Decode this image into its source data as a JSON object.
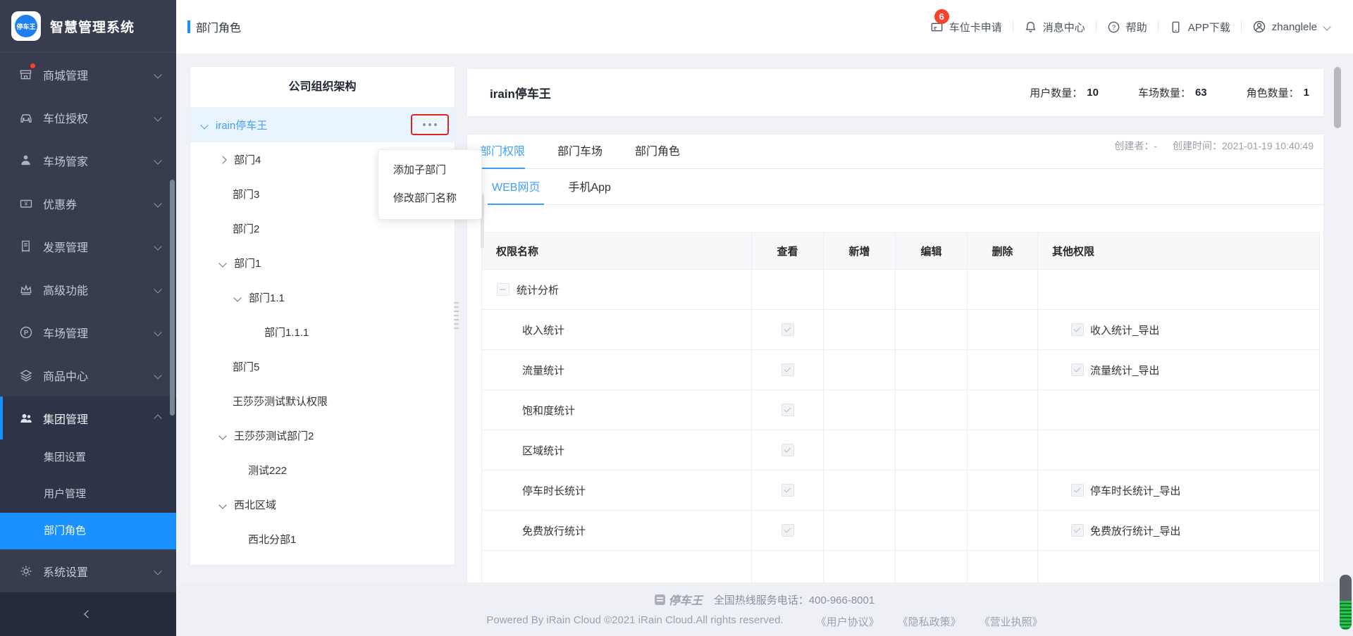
{
  "app": {
    "name": "智慧管理系统",
    "logo_badge": "停车王"
  },
  "sidebar": {
    "items": [
      {
        "label": "商城管理",
        "icon": "store-icon",
        "has_badge_dot": true
      },
      {
        "label": "车位授权",
        "icon": "car-icon"
      },
      {
        "label": "车场管家",
        "icon": "steward-icon"
      },
      {
        "label": "优惠券",
        "icon": "coupon-icon"
      },
      {
        "label": "发票管理",
        "icon": "invoice-icon"
      },
      {
        "label": "高级功能",
        "icon": "crown-icon"
      },
      {
        "label": "车场管理",
        "icon": "parking-icon"
      },
      {
        "label": "商品中心",
        "icon": "goods-icon"
      },
      {
        "label": "集团管理",
        "icon": "group-icon",
        "expanded": true
      },
      {
        "label": "系统设置",
        "icon": "settings-icon"
      }
    ],
    "group_children": [
      {
        "label": "集团设置"
      },
      {
        "label": "用户管理"
      },
      {
        "label": "部门角色",
        "active": true
      }
    ]
  },
  "header": {
    "breadcrumb": "部门角色",
    "badge_count": "6",
    "actions": [
      {
        "label": "车位卡申请",
        "icon": "card-icon"
      },
      {
        "label": "消息中心",
        "icon": "bell-icon"
      },
      {
        "label": "帮助",
        "icon": "help-icon"
      },
      {
        "label": "APP下载",
        "icon": "phone-icon"
      }
    ],
    "user": {
      "name": "zhanglele",
      "icon": "user-icon"
    }
  },
  "org_panel": {
    "title": "公司组织架构",
    "nodes": [
      {
        "label": "irain停车王",
        "level": 0,
        "caret": "down",
        "selected": true
      },
      {
        "label": "部门4",
        "level": 1,
        "caret": "right"
      },
      {
        "label": "部门3",
        "level": 1
      },
      {
        "label": "部门2",
        "level": 1
      },
      {
        "label": "部门1",
        "level": 1,
        "caret": "down"
      },
      {
        "label": "部门1.1",
        "level": 2,
        "caret": "down"
      },
      {
        "label": "部门1.1.1",
        "level": 3
      },
      {
        "label": "部门5",
        "level": 1
      },
      {
        "label": "王莎莎测试默认权限",
        "level": 1
      },
      {
        "label": "王莎莎测试部门2",
        "level": 1,
        "caret": "down"
      },
      {
        "label": "测试222",
        "level": 2
      },
      {
        "label": "西北区域",
        "level": 1,
        "caret": "down"
      },
      {
        "label": "西北分部1",
        "level": 2
      }
    ],
    "context_menu": [
      {
        "label": "添加子部门"
      },
      {
        "label": "修改部门名称"
      }
    ]
  },
  "content": {
    "company_name": "irain停车王",
    "stats": [
      {
        "label": "用户数量：",
        "value": "10"
      },
      {
        "label": "车场数量：",
        "value": "63"
      },
      {
        "label": "角色数量：",
        "value": "1"
      }
    ],
    "tabs": [
      {
        "label": "部门权限",
        "active": true
      },
      {
        "label": "部门车场"
      },
      {
        "label": "部门角色"
      }
    ],
    "meta": {
      "creator_label": "创建者：",
      "creator_value": "-",
      "created_label": "创建时间：",
      "created_value": "2021-01-19 10:40:49"
    },
    "subtabs": [
      {
        "label": "WEB网页",
        "active": true
      },
      {
        "label": "手机App"
      }
    ],
    "table": {
      "columns": [
        "权限名称",
        "查看",
        "新增",
        "编辑",
        "删除",
        "其他权限"
      ],
      "rows": [
        {
          "name": "统计分析",
          "is_group": true,
          "checkbox": "indeterminate"
        },
        {
          "name": "收入统计",
          "view": "checked",
          "other": "收入统计_导出"
        },
        {
          "name": "流量统计",
          "view": "checked",
          "other": "流量统计_导出"
        },
        {
          "name": "饱和度统计",
          "view": "checked",
          "other": ""
        },
        {
          "name": "区域统计",
          "view": "checked",
          "other": ""
        },
        {
          "name": "停车时长统计",
          "view": "checked",
          "other": "停车时长统计_导出"
        },
        {
          "name": "免费放行统计",
          "view": "checked",
          "other": "免费放行统计_导出"
        }
      ]
    }
  },
  "footer": {
    "logo_text": "停车王",
    "hotline": "全国热线服务电话：400-966-8001",
    "copyright": "Powered By iRain Cloud ©2021 iRain Cloud.All rights reserved.",
    "links": [
      {
        "label": "《用户协议》"
      },
      {
        "label": "《隐私政策》"
      },
      {
        "label": "《营业执照》"
      }
    ]
  },
  "colors": {
    "accent": "#409eff",
    "sidebar_active": "#1890ff",
    "badge": "#f5432c",
    "highlight_box": "#e1251b"
  }
}
